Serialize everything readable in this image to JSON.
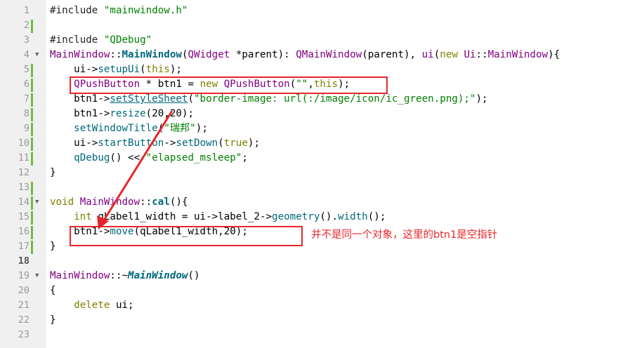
{
  "editor": {
    "line_numbers": [
      "1",
      "2",
      "3",
      "4",
      "5",
      "6",
      "7",
      "8",
      "9",
      "10",
      "11",
      "12",
      "13",
      "14",
      "15",
      "16",
      "17",
      "18",
      "19",
      "20",
      "21",
      "22",
      "23"
    ],
    "lines": {
      "l1": {
        "t0": "#include ",
        "t1": "\"mainwindow.h\""
      },
      "l3": {
        "t0": "#include ",
        "t1": "\"QDebug\""
      },
      "l4": {
        "t0": "MainWindow",
        "t1": "::",
        "t2": "MainWindow",
        "t3": "(",
        "t4": "QWidget",
        "t5": " *parent): ",
        "t6": "QMainWindow",
        "t7": "(parent), ",
        "t8": "ui",
        "t9": "(",
        "t10": "new",
        "t11": " ",
        "t12": "Ui",
        "t13": "::",
        "t14": "MainWindow",
        "t15": "){"
      },
      "l5": {
        "t0": "    ui->",
        "t1": "setupUi",
        "t2": "(",
        "t3": "this",
        "t4": ");"
      },
      "l6": {
        "t0": "    ",
        "t1": "QPushButton",
        "t2": " * btn1 = ",
        "t3": "new",
        "t4": " ",
        "t5": "QPushButton",
        "t6": "(",
        "t7": "\"\"",
        "t8": ",",
        "t9": "this",
        "t10": ");"
      },
      "l7": {
        "t0": "    btn1->",
        "t1": "setStyleSheet",
        "t2": "(",
        "t3": "\"border-image: url(:/image/icon/ic_green.png);\"",
        "t4": ");"
      },
      "l8": {
        "t0": "    btn1->",
        "t1": "resize",
        "t2": "(20,20);"
      },
      "l9": {
        "t0": "    ",
        "t1": "setWindowTitle",
        "t2": "(",
        "t3": "\"瑞邦\"",
        "t4": ");"
      },
      "l10": {
        "t0": "    ui->",
        "t1": "startButton",
        "t2": "->",
        "t3": "setDown",
        "t4": "(",
        "t5": "true",
        "t6": ");"
      },
      "l11": {
        "t0": "    ",
        "t1": "qDebug",
        "t2": "() << ",
        "t3": "\"elapsed_msleep\"",
        "t4": ";"
      },
      "l12": {
        "t0": "}"
      },
      "l14": {
        "t0": "void",
        "t1": " ",
        "t2": "MainWindow",
        "t3": "::",
        "t4": "cal",
        "t5": "(){"
      },
      "l15": {
        "t0": "    ",
        "t1": "int",
        "t2": " qLabel1_width = ui->label_2->",
        "t3": "geometry",
        "t4": "().",
        "t5": "width",
        "t6": "();"
      },
      "l16": {
        "t0": "    btn1->",
        "t1": "move",
        "t2": "(qLabel1_width,20);"
      },
      "l17": {
        "t0": "}"
      },
      "l19": {
        "t0": "MainWindow",
        "t1": "::~",
        "t2": "MainWindow",
        "t3": "()"
      },
      "l20": {
        "t0": "{"
      },
      "l21": {
        "t0": "    ",
        "t1": "delete",
        "t2": " ui;"
      },
      "l22": {
        "t0": "}"
      }
    }
  },
  "annotation": {
    "text": "并不是同一个对象，这里的btn1是空指针",
    "color": "#e8262a"
  },
  "colors": {
    "gutter": "#f0f0f0",
    "change_marker": "#6cbd45",
    "annotation_red": "#e8262a"
  }
}
